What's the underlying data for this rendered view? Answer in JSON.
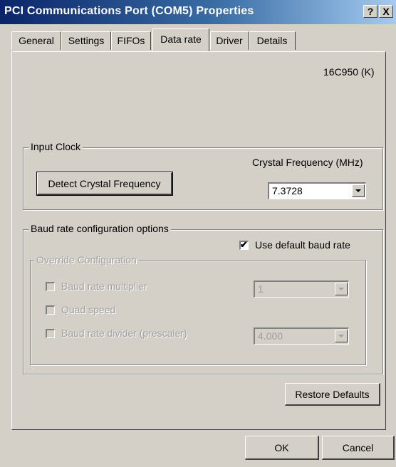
{
  "window": {
    "title": "PCI Communications Port (COM5) Properties",
    "help_button": "?",
    "close_button": "X"
  },
  "tabs": [
    "General",
    "Settings",
    "FIFOs",
    "Data rate",
    "Driver",
    "Details"
  ],
  "active_tab": "Data rate",
  "uart_model": "16C950 (K)",
  "input_clock": {
    "group_label": "Input Clock",
    "detect_button": "Detect Crystal Frequency",
    "crystal_freq_label": "Crystal Frequency (MHz)",
    "crystal_freq_value": "7.3728"
  },
  "baud": {
    "group_label": "Baud rate configuration options",
    "use_default_label": "Use default baud rate",
    "use_default_checked": true,
    "override": {
      "group_label": "Override Configuration",
      "multiplier_label": "Baud rate multiplier",
      "multiplier_value": "1",
      "quad_speed_label": "Quad speed",
      "divider_label": "Baud rate divider (prescaler)",
      "divider_value": "4.000"
    }
  },
  "buttons": {
    "restore_defaults": "Restore Defaults",
    "ok": "OK",
    "cancel": "Cancel"
  }
}
